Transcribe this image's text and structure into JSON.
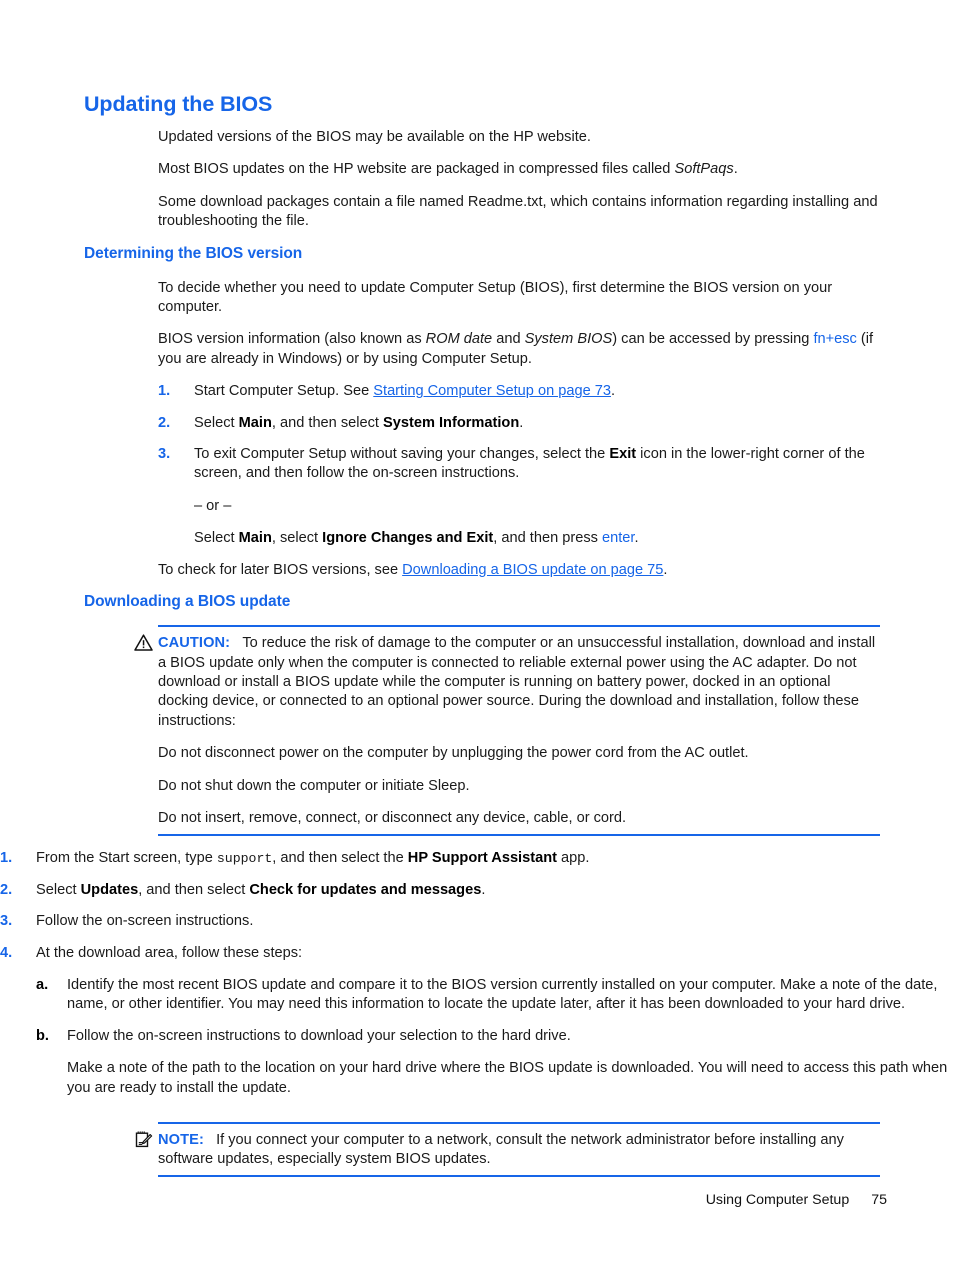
{
  "document": {
    "title": "Updating the BIOS",
    "accent_color": "#1665E8",
    "text_color": "#1a1a1a"
  },
  "intro": {
    "p1": "Updated versions of the BIOS may be available on the HP website.",
    "p2_before": "Most BIOS updates on the HP website are packaged in compressed files called ",
    "p2_italic": "SoftPaqs",
    "p2_after": ".",
    "p3": "Some download packages contain a file named Readme.txt, which contains information regarding installing and troubleshooting the file."
  },
  "section_determining": {
    "heading": "Determining the BIOS version",
    "p1": "To decide whether you need to update Computer Setup (BIOS), first determine the BIOS version on your computer.",
    "p2_a": "BIOS version information (also known as ",
    "p2_italic1": "ROM date",
    "p2_b": " and ",
    "p2_italic2": "System BIOS",
    "p2_c": ") can be accessed by pressing ",
    "p2_key1": "fn",
    "p2_plus": "+",
    "p2_key2": "esc",
    "p2_d": " (if you are already in Windows) or by using Computer Setup.",
    "steps": [
      {
        "num": "1.",
        "before": "Start Computer Setup. See ",
        "link": "Starting Computer Setup on page 73",
        "after": "."
      },
      {
        "num": "2.",
        "before": "Select ",
        "bold1": "Main",
        "mid": ", and then select ",
        "bold2": "System Information",
        "after": "."
      },
      {
        "num": "3.",
        "before": "To exit Computer Setup without saving your changes, select the ",
        "bold1": "Exit",
        "after": " icon in the lower-right corner of the screen, and then follow the on-screen instructions.",
        "or_text": "– or –",
        "alt_before": "Select ",
        "alt_bold1": "Main",
        "alt_mid": ", select ",
        "alt_bold2": "Ignore Changes and Exit",
        "alt_mid2": ", and then press ",
        "alt_key": "enter",
        "alt_after": "."
      }
    ],
    "closing_before": "To check for later BIOS versions, see ",
    "closing_link": "Downloading a BIOS update on page 75",
    "closing_after": "."
  },
  "section_downloading": {
    "heading": "Downloading a BIOS update",
    "caution": {
      "icon": "warning-triangle-icon",
      "label": "CAUTION:",
      "text": "To reduce the risk of damage to the computer or an unsuccessful installation, download and install a BIOS update only when the computer is connected to reliable external power using the AC adapter. Do not download or install a BIOS update while the computer is running on battery power, docked in an optional docking device, or connected to an optional power source. During the download and installation, follow these instructions:",
      "bullets": [
        "Do not disconnect power on the computer by unplugging the power cord from the AC outlet.",
        "Do not shut down the computer or initiate Sleep.",
        "Do not insert, remove, connect, or disconnect any device, cable, or cord."
      ]
    },
    "steps": [
      {
        "num": "1.",
        "before": "From the Start screen, type ",
        "mono": "support",
        "mid": ", and then select the ",
        "bold1": "HP Support Assistant",
        "after": " app."
      },
      {
        "num": "2.",
        "before": "Select ",
        "bold1": "Updates",
        "mid": ", and then select ",
        "bold2": "Check for updates and messages",
        "after": "."
      },
      {
        "num": "3.",
        "before": "Follow the on-screen instructions.",
        "after": ""
      },
      {
        "num": "4.",
        "before": "At the download area, follow these steps:",
        "after": "",
        "substeps": [
          {
            "num": "a.",
            "text": "Identify the most recent BIOS update and compare it to the BIOS version currently installed on your computer. Make a note of the date, name, or other identifier. You may need this information to locate the update later, after it has been downloaded to your hard drive."
          },
          {
            "num": "b.",
            "text": "Follow the on-screen instructions to download your selection to the hard drive.",
            "text2": "Make a note of the path to the location on your hard drive where the BIOS update is downloaded. You will need to access this path when you are ready to install the update."
          }
        ]
      }
    ],
    "note": {
      "icon": "note-pad-icon",
      "label": "NOTE:",
      "text": "If you connect your computer to a network, consult the network administrator before installing any software updates, especially system BIOS updates."
    }
  },
  "footer": {
    "chapter": "Using Computer Setup",
    "page_number": "75"
  }
}
